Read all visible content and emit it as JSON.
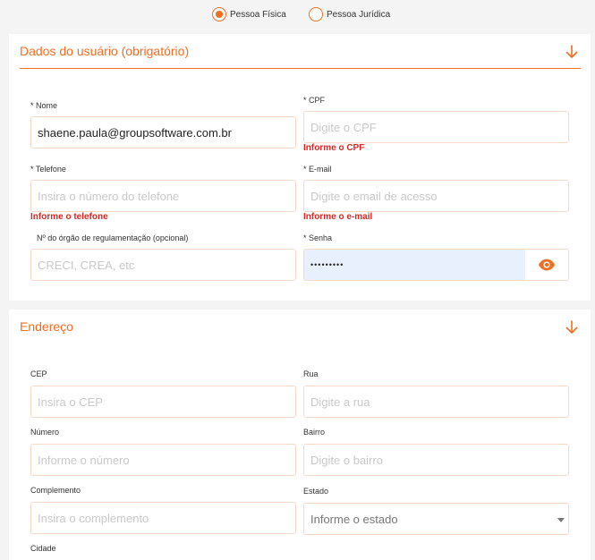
{
  "person_type": {
    "options": [
      {
        "label": "Pessoa Física",
        "selected": true
      },
      {
        "label": "Pessoa Jurídica",
        "selected": false
      }
    ]
  },
  "user_section": {
    "title": "Dados do usuário (obrigatório)",
    "nome": {
      "label": "* Nome",
      "value": "shaene.paula@groupsoftware.com.br"
    },
    "cpf": {
      "label": "* CPF",
      "placeholder": "Digite o CPF",
      "error": "Informe o CPF"
    },
    "telefone": {
      "label": "* Telefone",
      "placeholder": "Insira o número do telefone",
      "error": "Informe o telefone"
    },
    "email": {
      "label": "* E-mail",
      "placeholder": "Digite o email de acesso",
      "error": "Informe o e-mail"
    },
    "registro": {
      "label": "Nº do órgão de regulamentação (opcional)",
      "placeholder": "CRECI, CREA, etc"
    },
    "senha": {
      "label": "* Senha",
      "value": "•••••••••"
    }
  },
  "address_section": {
    "title": "Endereço",
    "cep": {
      "label": "CEP",
      "placeholder": "Insira o CEP"
    },
    "rua": {
      "label": "Rua",
      "placeholder": "Digite a rua"
    },
    "numero": {
      "label": "Número",
      "placeholder": "Informe o número"
    },
    "bairro": {
      "label": "Bairro",
      "placeholder": "Digite o bairro"
    },
    "complemento": {
      "label": "Complemento",
      "placeholder": "Insira o complemento"
    },
    "estado": {
      "label": "Estado",
      "selected": "Informe o estado"
    },
    "cidade": {
      "label": "Cidade"
    }
  },
  "colors": {
    "accent": "#f26e21",
    "error": "#d62828",
    "autofill": "#e8f0fe"
  }
}
